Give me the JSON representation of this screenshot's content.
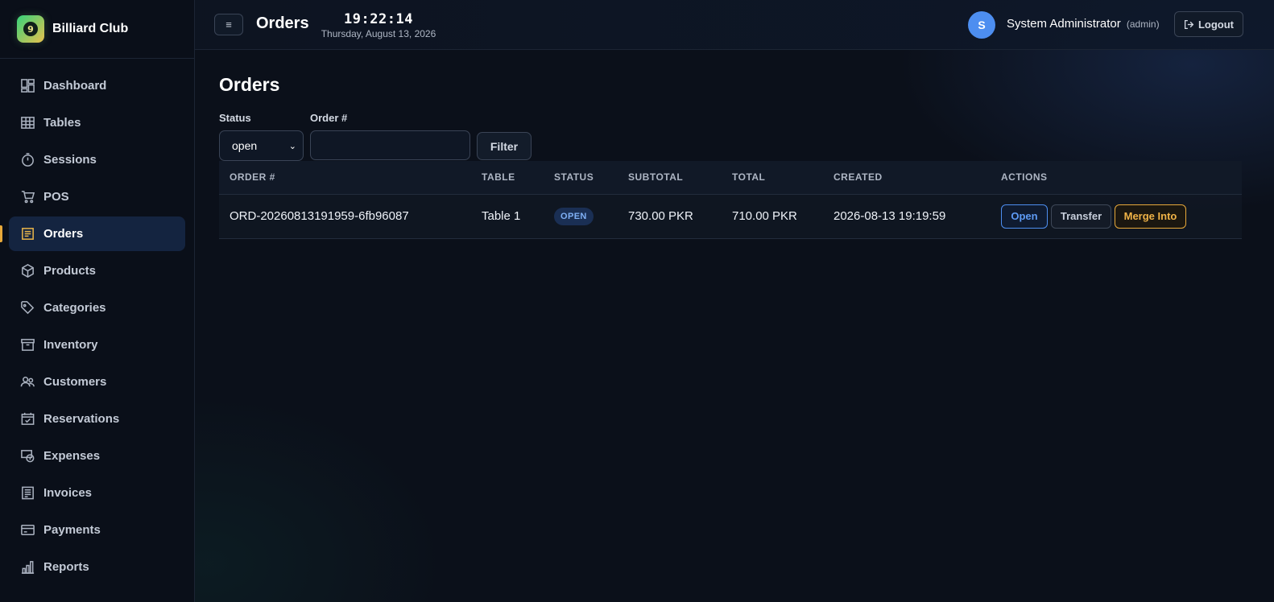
{
  "brand": {
    "name": "Billiard Club",
    "logo_glyph": "9"
  },
  "sidebar": {
    "items": [
      {
        "label": "Dashboard",
        "icon": "dashboard-icon",
        "active": false
      },
      {
        "label": "Tables",
        "icon": "table-grid-icon",
        "active": false
      },
      {
        "label": "Sessions",
        "icon": "stopwatch-icon",
        "active": false
      },
      {
        "label": "POS",
        "icon": "cart-icon",
        "active": false
      },
      {
        "label": "Orders",
        "icon": "receipt-icon",
        "active": true
      },
      {
        "label": "Products",
        "icon": "box-icon",
        "active": false
      },
      {
        "label": "Categories",
        "icon": "tags-icon",
        "active": false
      },
      {
        "label": "Inventory",
        "icon": "archive-icon",
        "active": false
      },
      {
        "label": "Customers",
        "icon": "people-icon",
        "active": false
      },
      {
        "label": "Reservations",
        "icon": "calendar-check-icon",
        "active": false
      },
      {
        "label": "Expenses",
        "icon": "cash-coin-icon",
        "active": false
      },
      {
        "label": "Invoices",
        "icon": "invoice-icon",
        "active": false
      },
      {
        "label": "Payments",
        "icon": "credit-card-icon",
        "active": false
      },
      {
        "label": "Reports",
        "icon": "bar-chart-icon",
        "active": false
      }
    ]
  },
  "topbar": {
    "menu_glyph": "≡",
    "title": "Orders",
    "clock_time": "19:22:14",
    "clock_date": "Thursday, August 13, 2026",
    "avatar_initial": "S",
    "user_name": "System Administrator",
    "user_role": "(admin)",
    "logout_label": "Logout"
  },
  "main": {
    "title": "Orders",
    "filters": {
      "status_label": "Status",
      "status_value": "open",
      "order_label": "Order #",
      "order_value": "",
      "filter_button": "Filter"
    },
    "table": {
      "headers": [
        "ORDER #",
        "TABLE",
        "STATUS",
        "SUBTOTAL",
        "TOTAL",
        "CREATED",
        "ACTIONS"
      ],
      "rows": [
        {
          "order_no": "ORD-20260813191959-6fb96087",
          "table": "Table 1",
          "status": "OPEN",
          "subtotal": "730.00 PKR",
          "total": "710.00 PKR",
          "created": "2026-08-13 19:19:59",
          "actions": {
            "open": "Open",
            "transfer": "Transfer",
            "merge": "Merge Into"
          }
        }
      ]
    }
  },
  "colors": {
    "accent_blue": "#4d8ef0",
    "accent_amber": "#e8a93a",
    "background": "#0b111c"
  }
}
